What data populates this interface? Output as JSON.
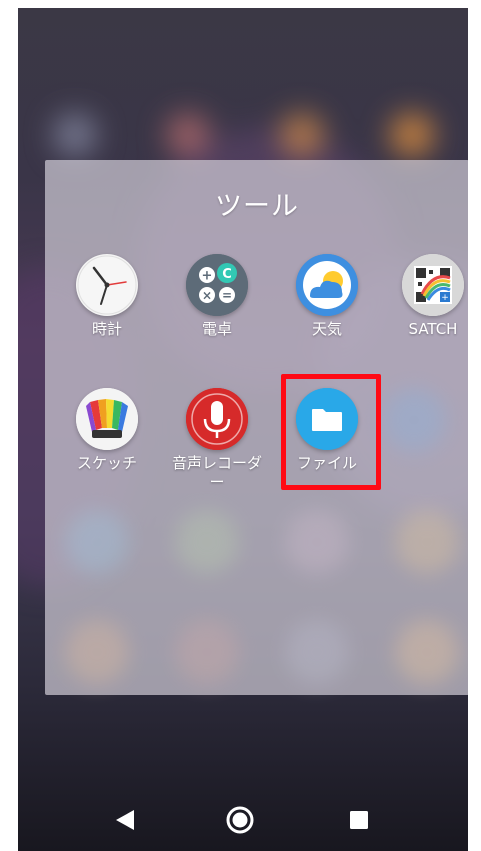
{
  "folder": {
    "title": "ツール",
    "apps": [
      {
        "name": "clock",
        "label": "時計",
        "icon": "clock-icon"
      },
      {
        "name": "calculator",
        "label": "電卓",
        "icon": "calculator-icon"
      },
      {
        "name": "weather",
        "label": "天気",
        "icon": "weather-icon"
      },
      {
        "name": "satch",
        "label": "SATCH",
        "icon": "satch-icon"
      },
      {
        "name": "sketch",
        "label": "スケッチ",
        "icon": "sketch-icon"
      },
      {
        "name": "voice-recorder",
        "label": "音声レコーダー",
        "icon": "microphone-icon"
      },
      {
        "name": "files",
        "label": "ファイル",
        "icon": "folder-icon"
      }
    ],
    "highlighted_app": "ファイル"
  },
  "navbar": {
    "buttons": [
      "back-icon",
      "home-icon",
      "recents-icon"
    ]
  },
  "colors": {
    "highlight_border": "#ff0a14",
    "files_icon": "#29a8e8",
    "recorder_icon": "#d62a2a",
    "weather_icon": "#3e8fe0"
  }
}
